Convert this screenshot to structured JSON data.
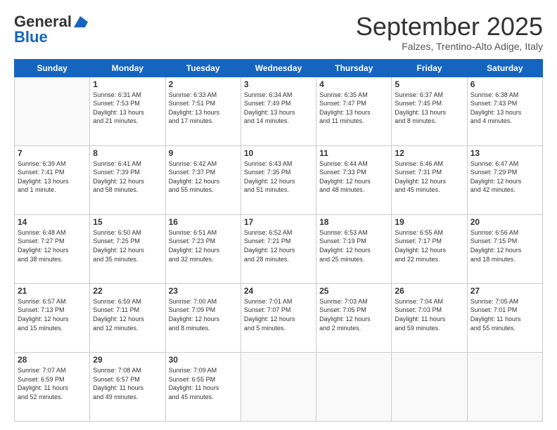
{
  "header": {
    "logo_general": "General",
    "logo_blue": "Blue",
    "month_title": "September 2025",
    "subtitle": "Falzes, Trentino-Alto Adige, Italy"
  },
  "days_of_week": [
    "Sunday",
    "Monday",
    "Tuesday",
    "Wednesday",
    "Thursday",
    "Friday",
    "Saturday"
  ],
  "weeks": [
    [
      {
        "day": "",
        "info": ""
      },
      {
        "day": "1",
        "info": "Sunrise: 6:31 AM\nSunset: 7:53 PM\nDaylight: 13 hours\nand 21 minutes."
      },
      {
        "day": "2",
        "info": "Sunrise: 6:33 AM\nSunset: 7:51 PM\nDaylight: 13 hours\nand 17 minutes."
      },
      {
        "day": "3",
        "info": "Sunrise: 6:34 AM\nSunset: 7:49 PM\nDaylight: 13 hours\nand 14 minutes."
      },
      {
        "day": "4",
        "info": "Sunrise: 6:35 AM\nSunset: 7:47 PM\nDaylight: 13 hours\nand 11 minutes."
      },
      {
        "day": "5",
        "info": "Sunrise: 6:37 AM\nSunset: 7:45 PM\nDaylight: 13 hours\nand 8 minutes."
      },
      {
        "day": "6",
        "info": "Sunrise: 6:38 AM\nSunset: 7:43 PM\nDaylight: 13 hours\nand 4 minutes."
      }
    ],
    [
      {
        "day": "7",
        "info": "Sunrise: 6:39 AM\nSunset: 7:41 PM\nDaylight: 13 hours\nand 1 minute."
      },
      {
        "day": "8",
        "info": "Sunrise: 6:41 AM\nSunset: 7:39 PM\nDaylight: 12 hours\nand 58 minutes."
      },
      {
        "day": "9",
        "info": "Sunrise: 6:42 AM\nSunset: 7:37 PM\nDaylight: 12 hours\nand 55 minutes."
      },
      {
        "day": "10",
        "info": "Sunrise: 6:43 AM\nSunset: 7:35 PM\nDaylight: 12 hours\nand 51 minutes."
      },
      {
        "day": "11",
        "info": "Sunrise: 6:44 AM\nSunset: 7:33 PM\nDaylight: 12 hours\nand 48 minutes."
      },
      {
        "day": "12",
        "info": "Sunrise: 6:46 AM\nSunset: 7:31 PM\nDaylight: 12 hours\nand 45 minutes."
      },
      {
        "day": "13",
        "info": "Sunrise: 6:47 AM\nSunset: 7:29 PM\nDaylight: 12 hours\nand 42 minutes."
      }
    ],
    [
      {
        "day": "14",
        "info": "Sunrise: 6:48 AM\nSunset: 7:27 PM\nDaylight: 12 hours\nand 38 minutes."
      },
      {
        "day": "15",
        "info": "Sunrise: 6:50 AM\nSunset: 7:25 PM\nDaylight: 12 hours\nand 35 minutes."
      },
      {
        "day": "16",
        "info": "Sunrise: 6:51 AM\nSunset: 7:23 PM\nDaylight: 12 hours\nand 32 minutes."
      },
      {
        "day": "17",
        "info": "Sunrise: 6:52 AM\nSunset: 7:21 PM\nDaylight: 12 hours\nand 28 minutes."
      },
      {
        "day": "18",
        "info": "Sunrise: 6:53 AM\nSunset: 7:19 PM\nDaylight: 12 hours\nand 25 minutes."
      },
      {
        "day": "19",
        "info": "Sunrise: 6:55 AM\nSunset: 7:17 PM\nDaylight: 12 hours\nand 22 minutes."
      },
      {
        "day": "20",
        "info": "Sunrise: 6:56 AM\nSunset: 7:15 PM\nDaylight: 12 hours\nand 18 minutes."
      }
    ],
    [
      {
        "day": "21",
        "info": "Sunrise: 6:57 AM\nSunset: 7:13 PM\nDaylight: 12 hours\nand 15 minutes."
      },
      {
        "day": "22",
        "info": "Sunrise: 6:59 AM\nSunset: 7:11 PM\nDaylight: 12 hours\nand 12 minutes."
      },
      {
        "day": "23",
        "info": "Sunrise: 7:00 AM\nSunset: 7:09 PM\nDaylight: 12 hours\nand 8 minutes."
      },
      {
        "day": "24",
        "info": "Sunrise: 7:01 AM\nSunset: 7:07 PM\nDaylight: 12 hours\nand 5 minutes."
      },
      {
        "day": "25",
        "info": "Sunrise: 7:03 AM\nSunset: 7:05 PM\nDaylight: 12 hours\nand 2 minutes."
      },
      {
        "day": "26",
        "info": "Sunrise: 7:04 AM\nSunset: 7:03 PM\nDaylight: 11 hours\nand 59 minutes."
      },
      {
        "day": "27",
        "info": "Sunrise: 7:05 AM\nSunset: 7:01 PM\nDaylight: 11 hours\nand 55 minutes."
      }
    ],
    [
      {
        "day": "28",
        "info": "Sunrise: 7:07 AM\nSunset: 6:59 PM\nDaylight: 11 hours\nand 52 minutes."
      },
      {
        "day": "29",
        "info": "Sunrise: 7:08 AM\nSunset: 6:57 PM\nDaylight: 11 hours\nand 49 minutes."
      },
      {
        "day": "30",
        "info": "Sunrise: 7:09 AM\nSunset: 6:55 PM\nDaylight: 11 hours\nand 45 minutes."
      },
      {
        "day": "",
        "info": ""
      },
      {
        "day": "",
        "info": ""
      },
      {
        "day": "",
        "info": ""
      },
      {
        "day": "",
        "info": ""
      }
    ]
  ]
}
